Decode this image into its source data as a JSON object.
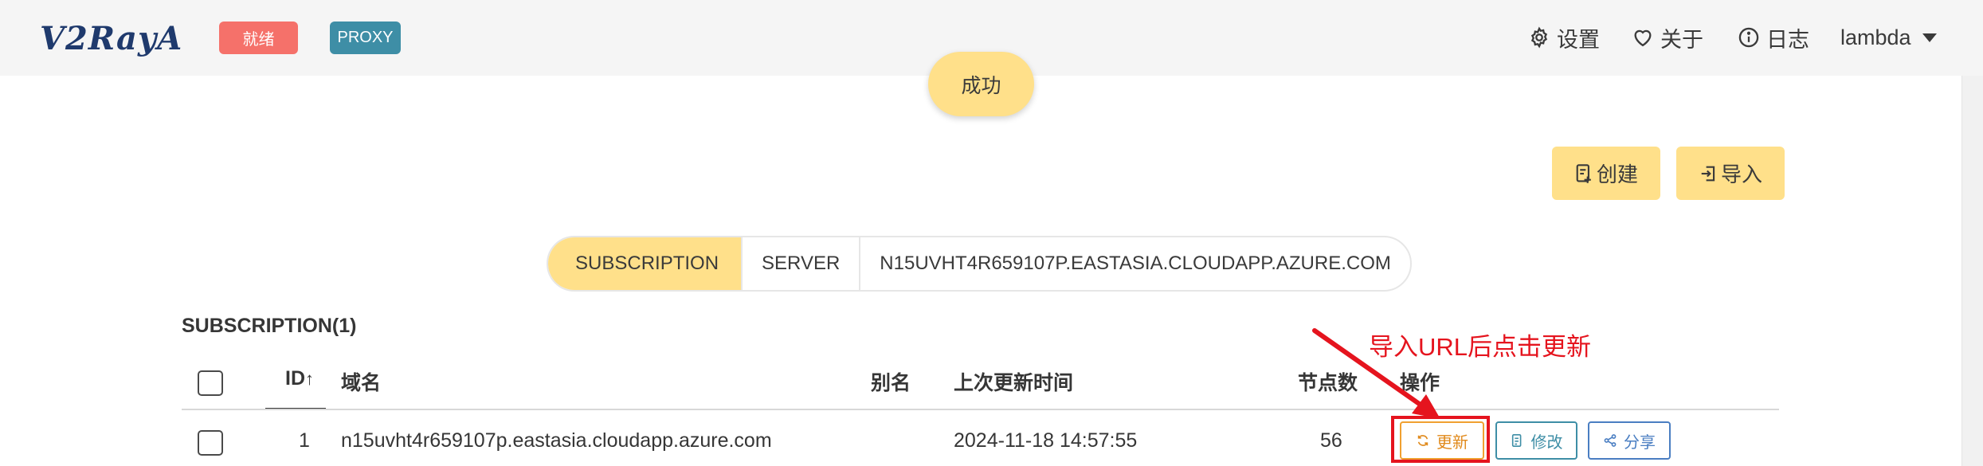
{
  "navbar": {
    "logo": "V2RayA",
    "status_tag": "就绪",
    "proxy_tag": "PROXY",
    "settings_label": "设置",
    "about_label": "关于",
    "log_label": "日志",
    "user_label": "lambda"
  },
  "toast": "成功",
  "actions": {
    "create_label": "创建",
    "import_label": "导入"
  },
  "tabs": [
    "SUBSCRIPTION",
    "SERVER",
    "N15UVHT4R659107P.EASTASIA.CLOUDAPP.AZURE.COM"
  ],
  "section_title": "SUBSCRIPTION(1)",
  "table": {
    "headers": {
      "id": "ID",
      "domain": "域名",
      "alias": "别名",
      "updated": "上次更新时间",
      "nodes": "节点数",
      "ops": "操作"
    },
    "rows": [
      {
        "id": "1",
        "domain": "n15uvht4r659107p.eastasia.cloudapp.azure.com",
        "alias": "",
        "updated": "2024-11-18 14:57:55",
        "nodes": "56",
        "update_label": "更新",
        "edit_label": "修改",
        "share_label": "分享"
      }
    ]
  },
  "annotation": "导入URL后点击更新",
  "colors": {
    "primary_yellow": "#ffe08a",
    "danger_tag": "#f5716a",
    "proxy_tag": "#3e8ea6",
    "annotation_red": "#e5141e"
  }
}
